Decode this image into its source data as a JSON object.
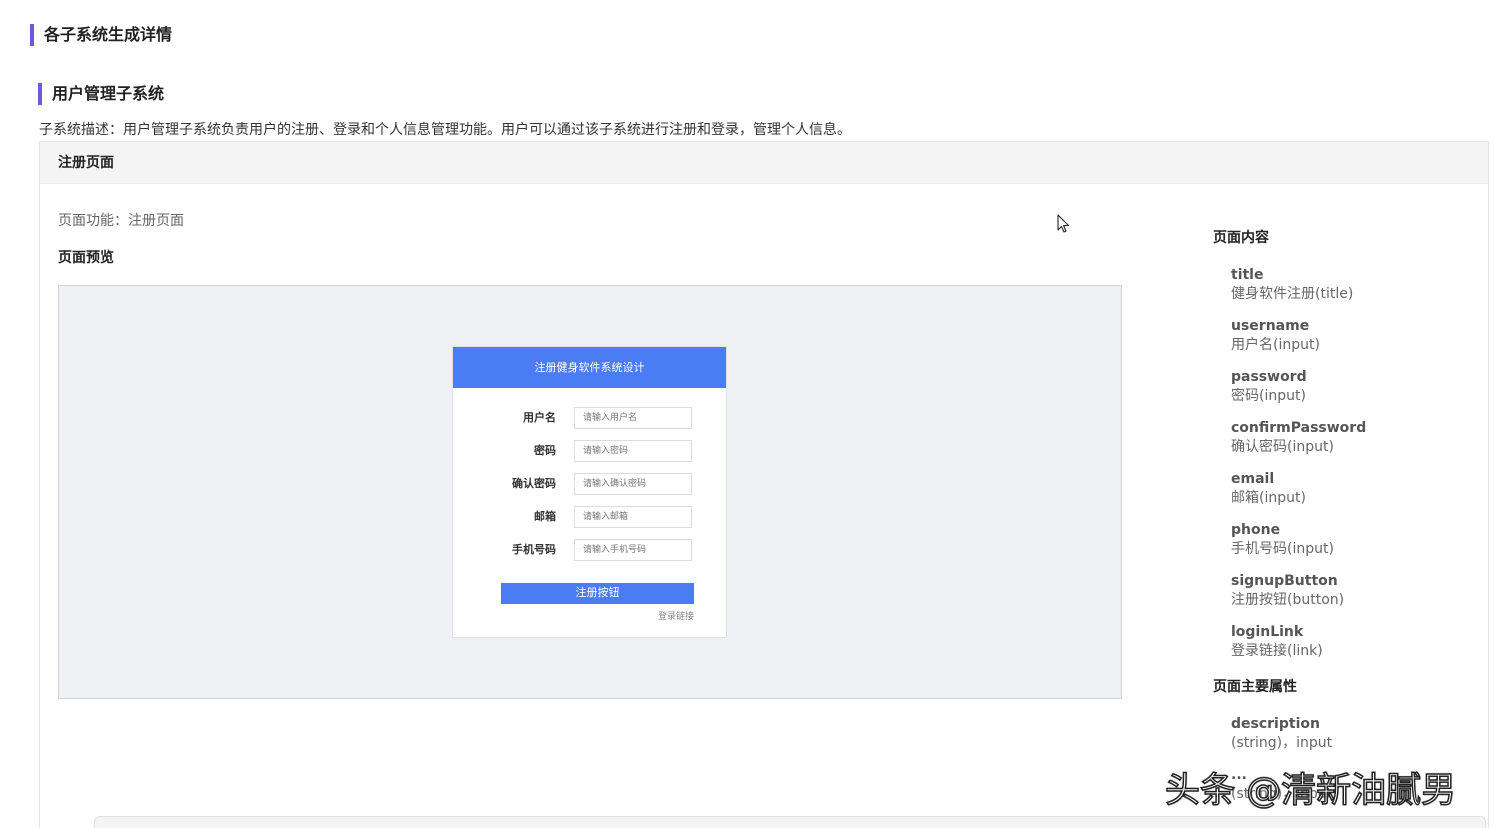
{
  "header": {
    "section_title": "各子系统生成详情",
    "subsystem_title": "用户管理子系统",
    "subsystem_desc": "子系统描述：用户管理子系统负责用户的注册、登录和个人信息管理功能。用户可以通过该子系统进行注册和登录，管理个人信息。"
  },
  "card": {
    "title": "注册页面",
    "page_function": "页面功能：注册页面",
    "preview_label": "页面预览"
  },
  "preview_form": {
    "title": "注册健身软件系统设计",
    "fields": [
      {
        "label": "用户名",
        "placeholder": "请输入用户名"
      },
      {
        "label": "密码",
        "placeholder": "请输入密码"
      },
      {
        "label": "确认密码",
        "placeholder": "请输入确认密码"
      },
      {
        "label": "邮箱",
        "placeholder": "请输入邮箱"
      },
      {
        "label": "手机号码",
        "placeholder": "请输入手机号码"
      }
    ],
    "button_label": "注册按钮",
    "link_label": "登录链接"
  },
  "page_content": {
    "heading": "页面内容",
    "items": [
      {
        "key": "title",
        "value": "健身软件注册(title)"
      },
      {
        "key": "username",
        "value": "用户名(input)"
      },
      {
        "key": "password",
        "value": "密码(input)"
      },
      {
        "key": "confirmPassword",
        "value": "确认密码(input)"
      },
      {
        "key": "email",
        "value": "邮箱(input)"
      },
      {
        "key": "phone",
        "value": "手机号码(input)"
      },
      {
        "key": "signupButton",
        "value": "注册按钮(button)"
      },
      {
        "key": "loginLink",
        "value": "登录链接(link)"
      }
    ]
  },
  "page_attrs": {
    "heading": "页面主要属性",
    "items": [
      {
        "key": "description",
        "value": "(string)，input"
      },
      {
        "key": "...",
        "value": "(string)，input"
      }
    ]
  },
  "watermark": "头条 @清新油腻男",
  "colors": {
    "accent": "#6a5ae0",
    "primary": "#4a7cf3",
    "preview_bg": "#eff0f3"
  }
}
